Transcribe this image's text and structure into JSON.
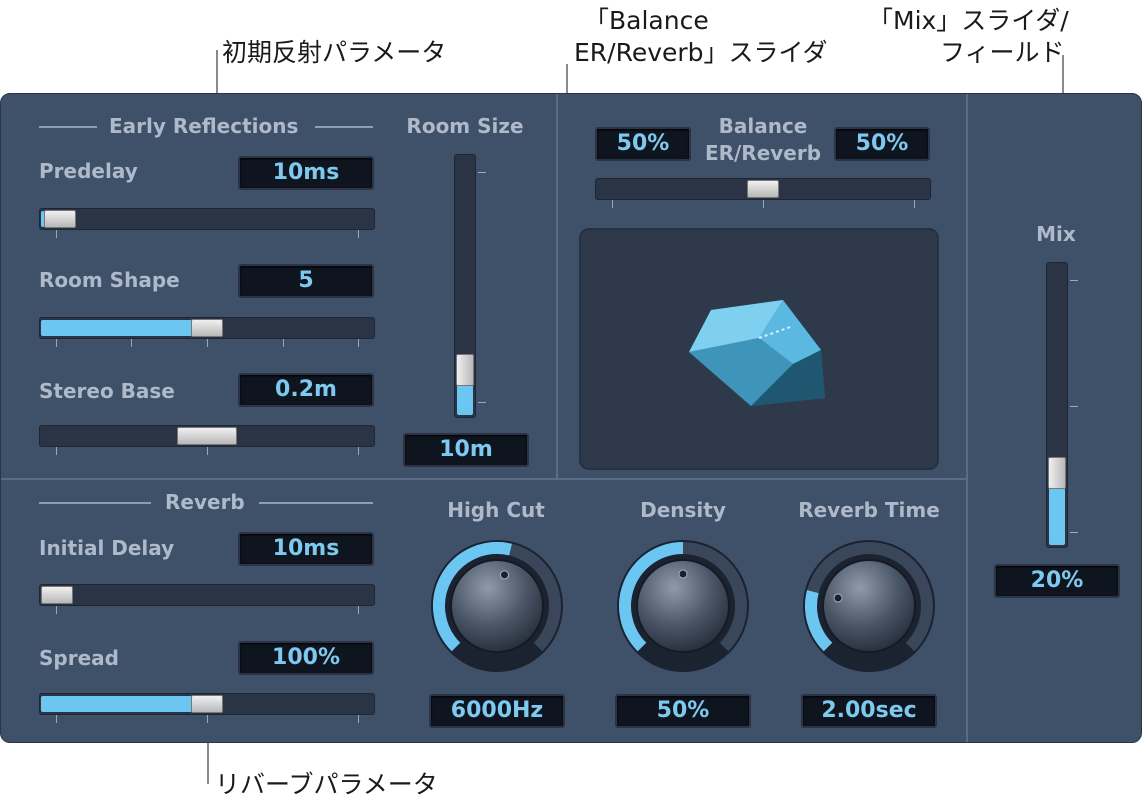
{
  "callouts": {
    "early_params": "初期反射パラメータ",
    "balance_line1": "「Balance",
    "balance_line2": "ER/Reverb」スライダ",
    "mix_line1": "「Mix」スライダ/",
    "mix_line2": "フィールド",
    "reverb_params": "リバーブパラメータ"
  },
  "early": {
    "section_title": "Early Reflections",
    "predelay_label": "Predelay",
    "predelay_value": "10ms",
    "predelay_level": 0.06,
    "room_shape_label": "Room Shape",
    "room_shape_value": "5",
    "room_shape_level": 0.5,
    "stereo_base_label": "Stereo Base",
    "stereo_base_value": "0.2m",
    "stereo_base_level": 0.5,
    "room_size_label": "Room Size",
    "room_size_value": "10m",
    "room_size_level": 0.1
  },
  "balance": {
    "label_line1": "Balance",
    "label_line2": "ER/Reverb",
    "left_value": "50%",
    "right_value": "50%",
    "level": 0.5
  },
  "mix": {
    "label": "Mix",
    "value": "20%",
    "level": 0.2
  },
  "reverb": {
    "section_title": "Reverb",
    "initial_delay_label": "Initial Delay",
    "initial_delay_value": "10ms",
    "initial_delay_level": 0.05,
    "spread_label": "Spread",
    "spread_value": "100%",
    "spread_level": 0.5
  },
  "knobs": {
    "high_cut_label": "High Cut",
    "high_cut_value": "6000Hz",
    "high_cut_level": 0.55,
    "density_label": "Density",
    "density_value": "50%",
    "density_level": 0.5,
    "reverb_time_label": "Reverb Time",
    "reverb_time_value": "2.00sec",
    "reverb_time_level": 0.22
  },
  "colors": {
    "panel": "#3f5069",
    "accent": "#6cc6f2",
    "lcd_text": "#7ec9f0"
  }
}
